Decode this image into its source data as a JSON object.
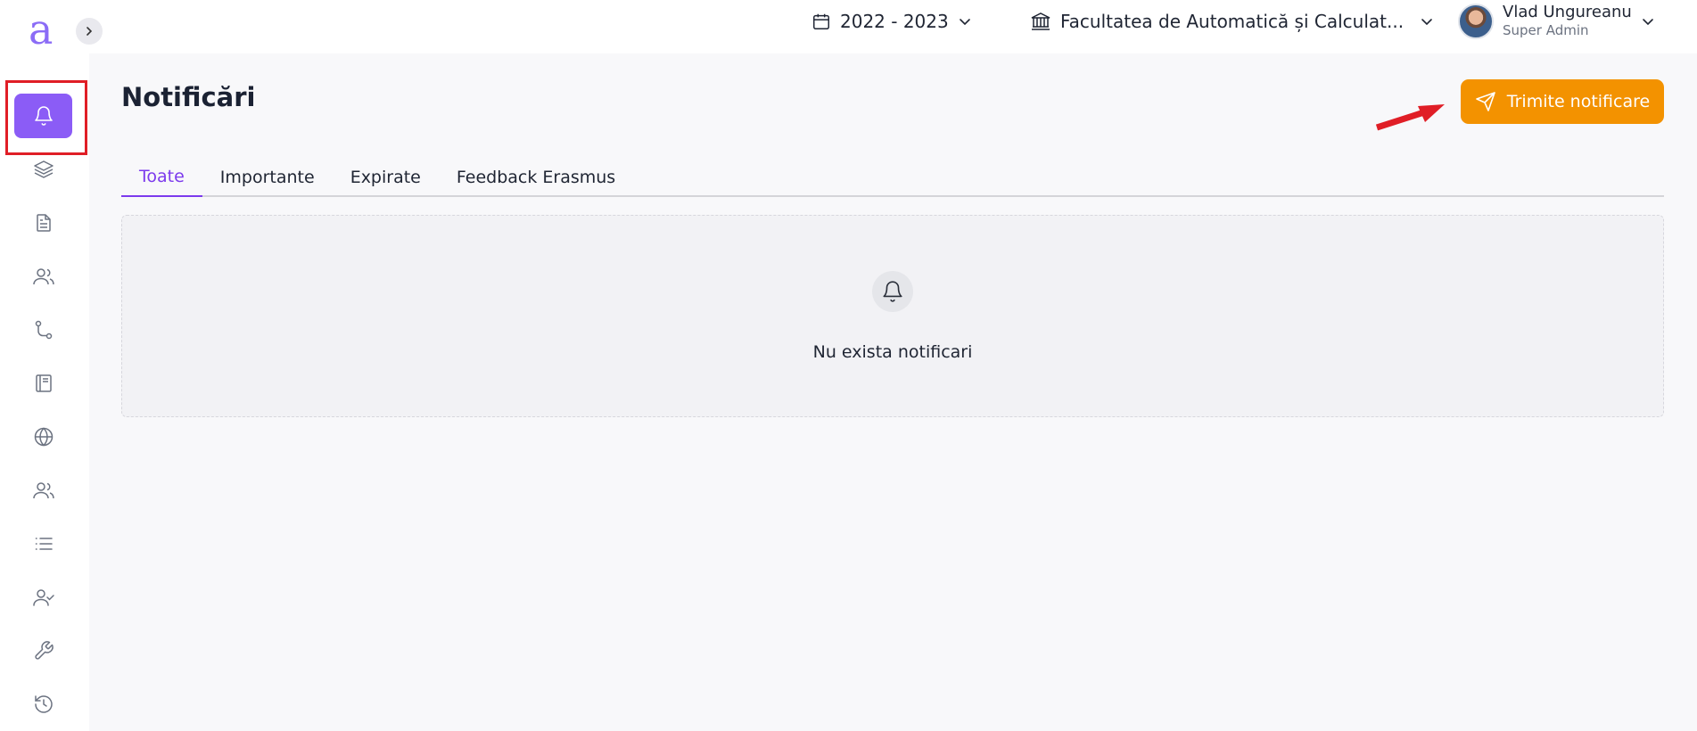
{
  "app": {
    "logo_text": "a",
    "brand_color": "#8b5cf6",
    "accent_color": "#f39200"
  },
  "sidebar": {
    "items": [
      {
        "name": "notifications",
        "icon": "bell-icon",
        "active": true
      },
      {
        "name": "layers",
        "icon": "layers-icon",
        "active": false
      },
      {
        "name": "documents",
        "icon": "document-icon",
        "active": false
      },
      {
        "name": "users",
        "icon": "users-icon",
        "active": false
      },
      {
        "name": "routes",
        "icon": "route-icon",
        "active": false
      },
      {
        "name": "book",
        "icon": "book-icon",
        "active": false
      },
      {
        "name": "globe",
        "icon": "globe-icon",
        "active": false
      },
      {
        "name": "groups",
        "icon": "users-icon",
        "active": false
      },
      {
        "name": "list",
        "icon": "list-icon",
        "active": false
      },
      {
        "name": "user-check",
        "icon": "user-check-icon",
        "active": false
      },
      {
        "name": "tools",
        "icon": "wrench-icon",
        "active": false
      },
      {
        "name": "history",
        "icon": "history-icon",
        "active": false
      }
    ]
  },
  "topbar": {
    "year": "2022 - 2023",
    "faculty": "Facultatea de Automatică și Calculat...",
    "user_name": "Vlad Ungureanu",
    "user_role": "Super Admin"
  },
  "main": {
    "title": "Notificări",
    "send_button": "Trimite notificare",
    "tabs": [
      {
        "label": "Toate",
        "active": true
      },
      {
        "label": "Importante",
        "active": false
      },
      {
        "label": "Expirate",
        "active": false
      },
      {
        "label": "Feedback Erasmus",
        "active": false
      }
    ],
    "empty_message": "Nu exista notificari"
  }
}
